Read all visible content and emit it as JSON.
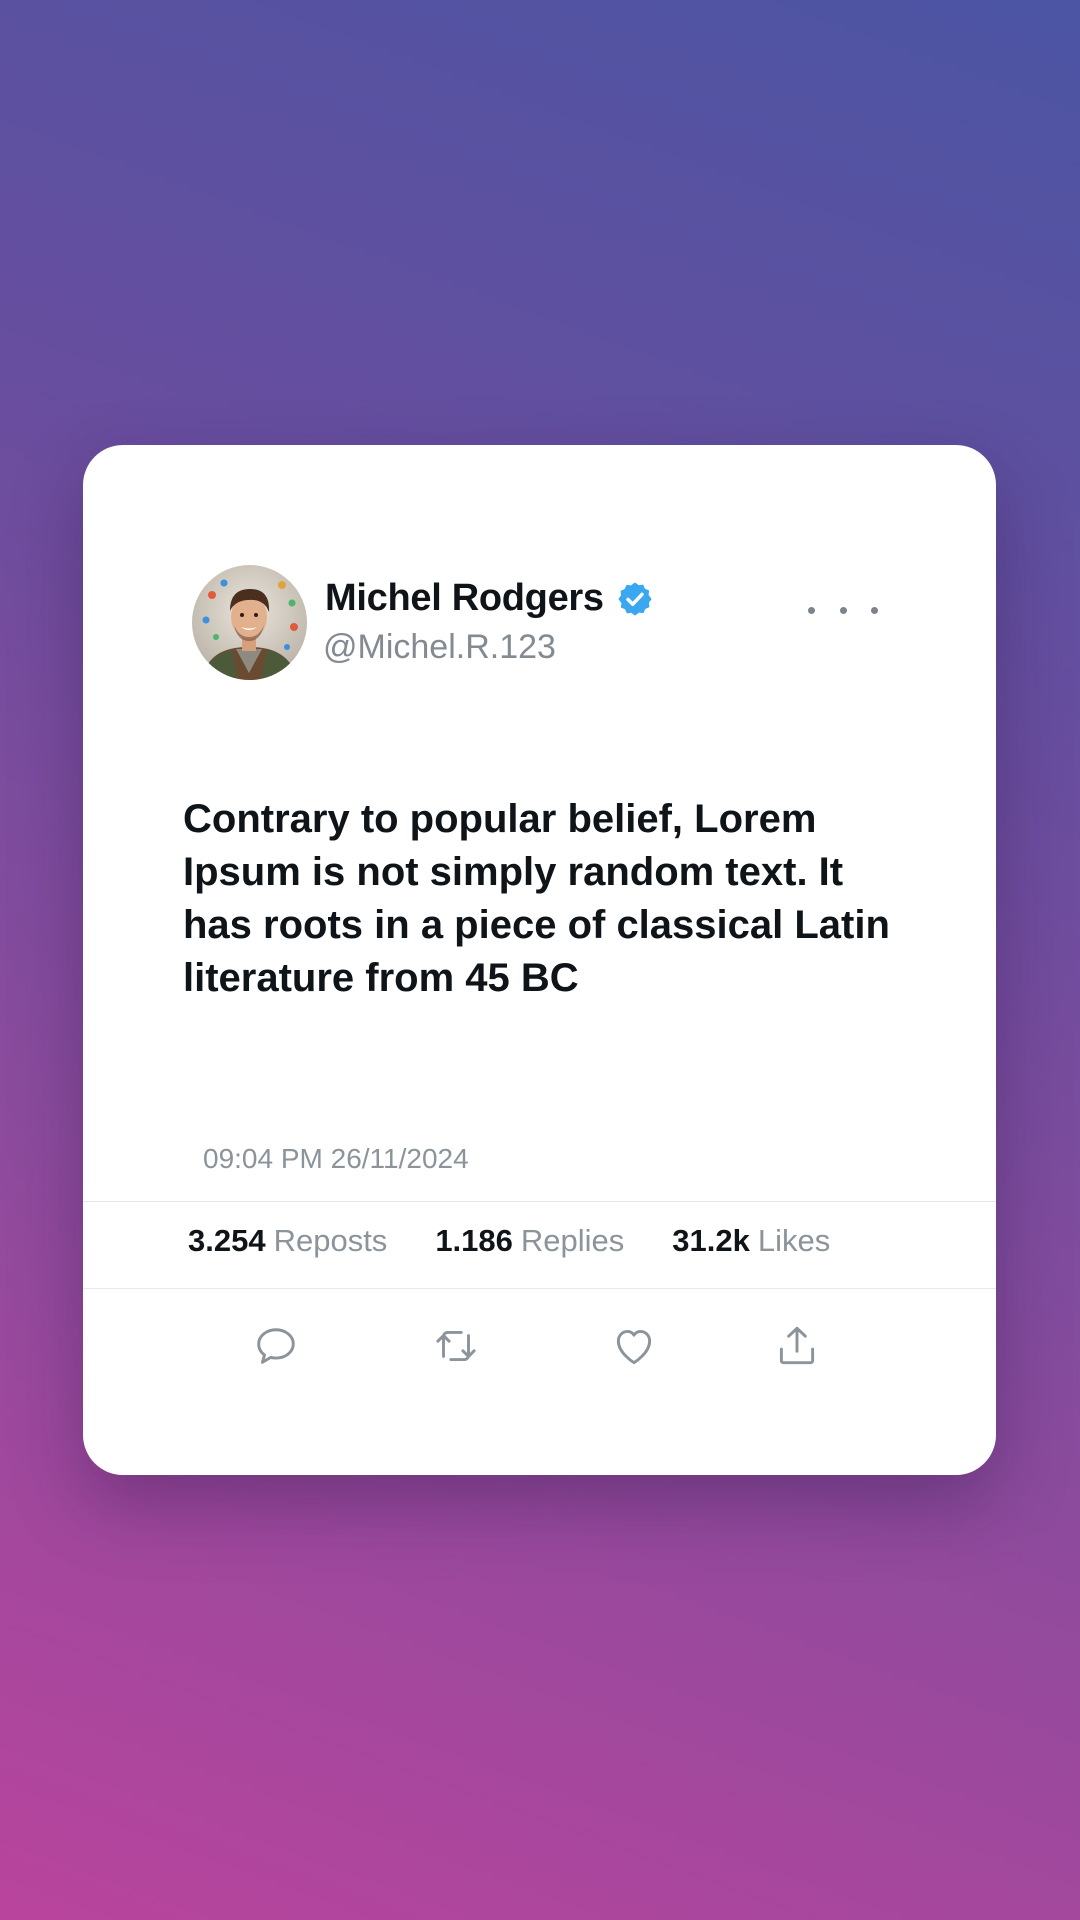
{
  "user": {
    "name": "Michel Rodgers",
    "handle": "@Michel.R.123",
    "verified": true
  },
  "post": {
    "text": "Contrary to popular belief, Lorem Ipsum is not simply random text. It has roots in a piece of classical Latin literature from 45 BC",
    "timestamp": "09:04 PM 26/11/2024"
  },
  "stats": {
    "reposts": {
      "value": "3.254",
      "label": "Reposts"
    },
    "replies": {
      "value": "1.186",
      "label": "Replies"
    },
    "likes": {
      "value": "31.2k",
      "label": "Likes"
    }
  },
  "icons": {
    "menu": "more-horizontal-icon",
    "verified": "verified-badge-icon",
    "actions": [
      "reply-icon",
      "repost-icon",
      "like-icon",
      "share-icon"
    ]
  },
  "colors": {
    "background_top": "#4b55a3",
    "background_bottom": "#b9449d",
    "verified": "#3aa8f0",
    "text_primary": "#0f1419",
    "text_secondary": "#8b939b"
  }
}
